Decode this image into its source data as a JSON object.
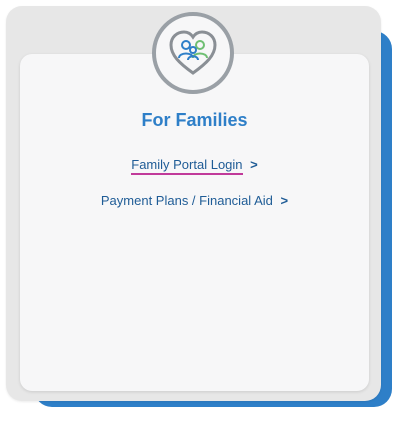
{
  "card": {
    "title": "For Families",
    "icon": "heart-family-icon",
    "accent_color": "#2e7fc8",
    "frame_color": "#e7e7e7",
    "link_color": "#1f5c96",
    "underline_color": "#c13a9a"
  },
  "links": [
    {
      "label": "Family Portal Login",
      "chevron": ">"
    },
    {
      "label": "Payment Plans / Financial Aid",
      "chevron": ">"
    }
  ]
}
